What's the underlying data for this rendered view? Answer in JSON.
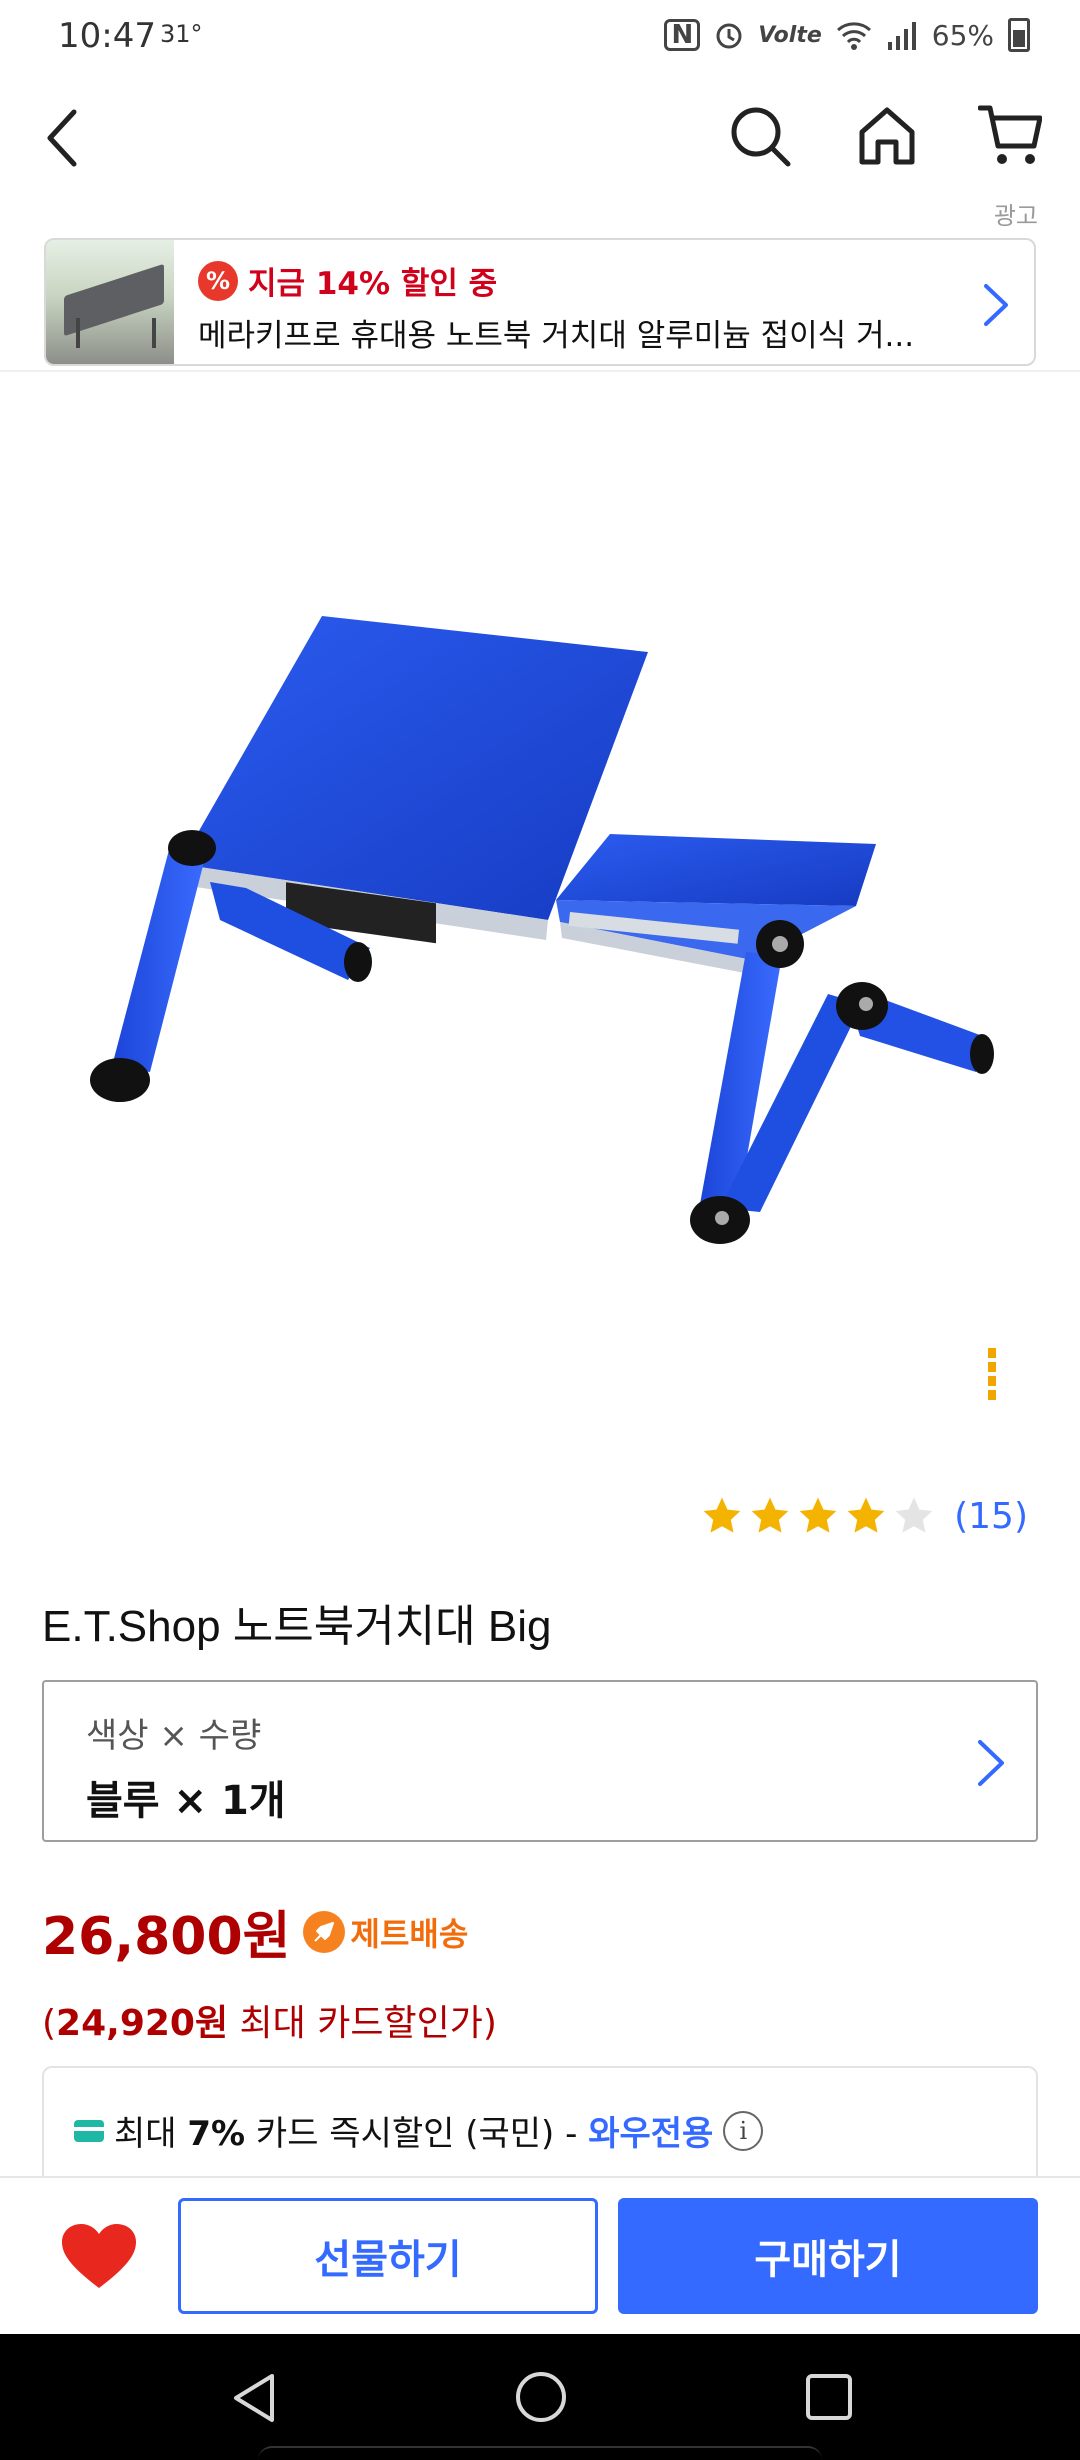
{
  "status_bar": {
    "time": "10:47",
    "temperature": "31°",
    "battery": "65%",
    "network": "Volte"
  },
  "ad": {
    "tag": "광고",
    "discount_badge": "%",
    "discount_text": "지금 14% 할인 중",
    "title": "메라키프로 휴대용 노트북 거치대 알루미늄 접이식 거..."
  },
  "product": {
    "rating": 4,
    "rating_max": 5,
    "review_count": "(15)",
    "title": "E.T.Shop 노트북거치대 Big",
    "color": "#1f4fe0"
  },
  "option": {
    "label": "색상 × 수량",
    "value": "블루 × 1개"
  },
  "price": {
    "amount": "26,800원",
    "delivery_badge": "제트배송",
    "card_price": "24,920원",
    "card_price_suffix": "최대 카드할인가"
  },
  "card_discount": {
    "text_prefix": "최대 ",
    "percent": "7%",
    "text_suffix": " 카드 즉시할인 (국민) - ",
    "wow_label": "와우전용",
    "info_icon": "i"
  },
  "actions": {
    "gift_label": "선물하기",
    "buy_label": "구매하기"
  },
  "colors": {
    "accent": "#346aff",
    "price": "#ae0000",
    "rocket": "#f26c0c",
    "heart": "#e8281e",
    "star": "#f5b301"
  }
}
